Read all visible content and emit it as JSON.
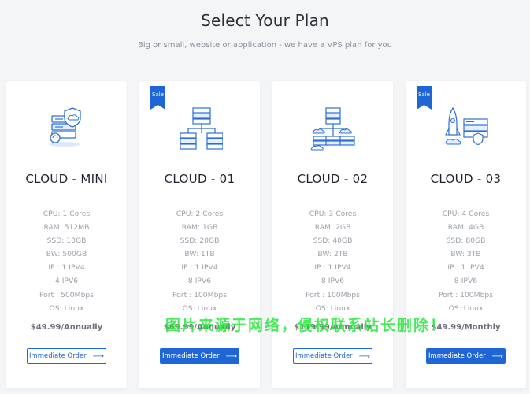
{
  "header": {
    "title": "Select Your Plan",
    "subtitle": "Big or small, website or application - we have a VPS plan for you"
  },
  "plans": [
    {
      "name": "CLOUD - MINI",
      "sale": false,
      "specs": [
        "CPU: 1 Cores",
        "RAM: 512MB",
        "SSD: 10GB",
        "BW: 500GB",
        "IP : 1 IPV4",
        "4 IPV6",
        "Port : 500Mbps",
        "OS: Linux"
      ],
      "price": "$49.99/Annually",
      "button": "Immediate Order",
      "button_style": "outline",
      "icon": "server-shield-illustration-icon"
    },
    {
      "name": "CLOUD - 01",
      "sale": true,
      "sale_label": "Sale",
      "specs": [
        "CPU: 2 Cores",
        "RAM: 1GB",
        "SSD: 20GB",
        "BW: 1TB",
        "IP : 1 IPV4",
        "8 IPV6",
        "Port : 100Mbps",
        "OS: Linux"
      ],
      "price": "$69.99/Annually",
      "button": "Immediate Order",
      "button_style": "solid",
      "icon": "server-network-illustration-icon"
    },
    {
      "name": "CLOUD - 02",
      "sale": false,
      "specs": [
        "CPU: 3 Cores",
        "RAM: 2GB",
        "SSD: 40GB",
        "BW: 2TB",
        "IP : 1 IPV4",
        "8 IPV6",
        "Port : 100Mbps",
        "OS: Linux"
      ],
      "price": "$119.99/Annually",
      "button": "Immediate Order",
      "button_style": "outline",
      "icon": "server-cloud-illustration-icon"
    },
    {
      "name": "CLOUD - 03",
      "sale": true,
      "sale_label": "Sale",
      "specs": [
        "CPU: 4 Cores",
        "RAM: 4GB",
        "SSD: 80GB",
        "BW: 3TB",
        "IP : 1 IPV4",
        "8 IPV6",
        "Port : 100Mbps",
        "OS: Linux"
      ],
      "price": "$49.99/Monthly",
      "button": "Immediate Order",
      "button_style": "solid",
      "icon": "server-rocket-illustration-icon"
    }
  ],
  "watermark": "图片来源于网络，侵权联系站长删除！",
  "colors": {
    "accent": "#1e66d6",
    "background": "#f4f5f7",
    "watermark": "#28e63c"
  }
}
